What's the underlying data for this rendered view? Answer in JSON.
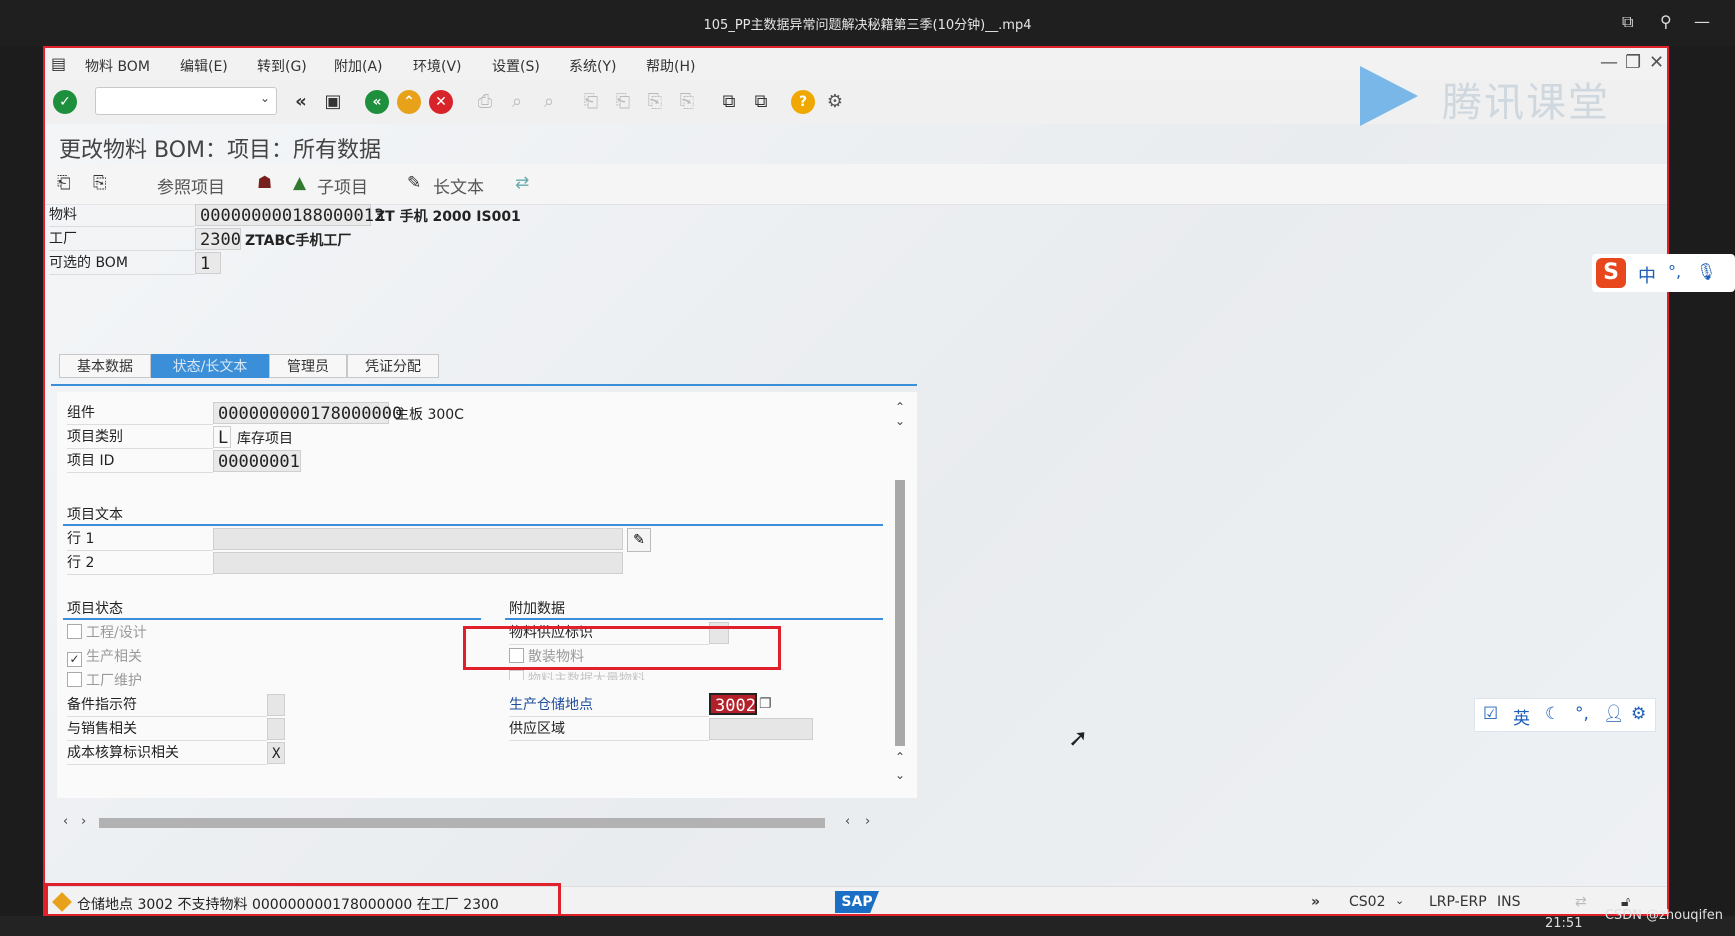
{
  "video": {
    "title": "105_PP主数据异常问题解决秘籍第三季(10分钟)__.mp4"
  },
  "menu": [
    "物料 BOM",
    "编辑(E)",
    "转到(G)",
    "附加(A)",
    "环境(V)",
    "设置(S)",
    "系统(Y)",
    "帮助(H)"
  ],
  "watermark": "腾讯课堂",
  "page_title": "更改物料 BOM：项目：所有数据",
  "app_toolbar": {
    "ref_item": "参照项目",
    "sub_item": "子项目",
    "long_text": "长文本"
  },
  "header": {
    "material_label": "物料",
    "material_value": "000000000188000013",
    "material_desc": "ZT 手机 2000 IS001",
    "plant_label": "工厂",
    "plant_value": "2300",
    "plant_desc": "ZTABC手机工厂",
    "alt_bom_label": "可选的 BOM",
    "alt_bom_value": "1"
  },
  "tabs": [
    "基本数据",
    "状态/长文本",
    "管理员",
    "凭证分配"
  ],
  "item": {
    "component_label": "组件",
    "component_value": "000000000178000000",
    "component_desc": "主板 300C",
    "category_label": "项目类别",
    "category_value": "L",
    "category_desc": "库存项目",
    "id_label": "项目 ID",
    "id_value": "00000001"
  },
  "item_text": {
    "section": "项目文本",
    "line1": "行 1",
    "line2": "行 2"
  },
  "item_status": {
    "section": "项目状态",
    "engineering": "工程/设计",
    "production": "生产相关",
    "plant_maint": "工厂维护",
    "spare_label": "备件指示符",
    "sales_label": "与销售相关",
    "costing_label": "成本核算标识相关",
    "costing_value": "X"
  },
  "additional": {
    "section": "附加数据",
    "supply_label": "物料供应标识",
    "bulk": "散装物料",
    "bulk_master": "物料主数据大量物料",
    "sloc_label": "生产仓储地点",
    "sloc_value": "3002",
    "supply_area_label": "供应区域"
  },
  "status_bar": {
    "message": "仓储地点 3002 不支持物料 000000000178000000 在工厂 2300",
    "sap": "SAP",
    "tcode": "CS02",
    "system": "LRP-ERP",
    "mode": "INS"
  },
  "ime": {
    "lang1": "中",
    "lang2": "英"
  },
  "taskbar": {
    "time": "21:51"
  },
  "credit": "CSDN @zhouqifen"
}
